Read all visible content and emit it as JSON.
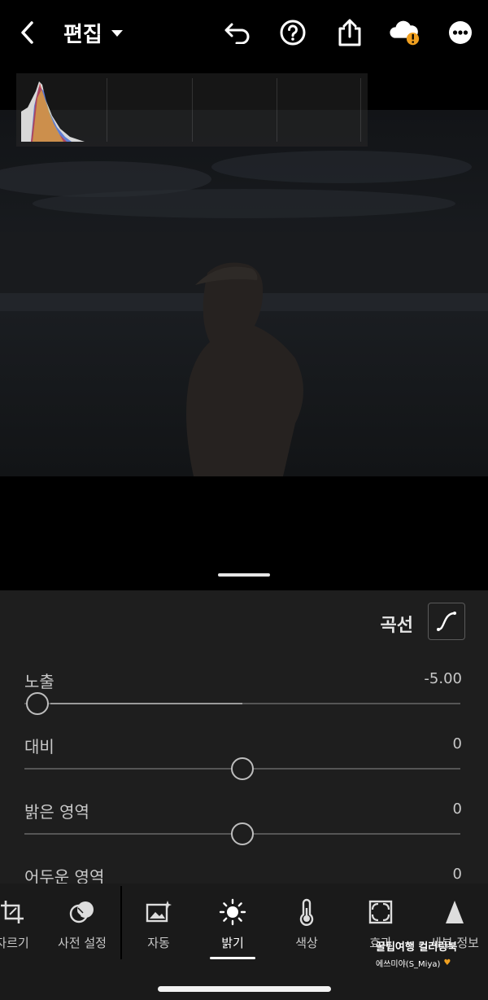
{
  "header": {
    "title": "편집"
  },
  "curve": {
    "label": "곡선"
  },
  "sliders": [
    {
      "label": "노출",
      "value": "-5.00",
      "level": 0.0
    },
    {
      "label": "대비",
      "value": "0",
      "level": 0.5
    },
    {
      "label": "밝은 영역",
      "value": "0",
      "level": 0.5
    },
    {
      "label": "어두운 영역",
      "value": "0",
      "level": 0.5
    }
  ],
  "tabs": [
    {
      "label": "자르기",
      "icon": "crop-icon"
    },
    {
      "label": "사전 설정",
      "icon": "presets-icon"
    },
    {
      "label": "자동",
      "icon": "auto-icon"
    },
    {
      "label": "밝기",
      "icon": "light-icon"
    },
    {
      "label": "색상",
      "icon": "color-thermometer-icon"
    },
    {
      "label": "효과",
      "icon": "effects-icon"
    },
    {
      "label": "세부 정보",
      "icon": "detail-icon"
    }
  ],
  "watermark": {
    "line1": "꿀팁여행 컬러링북",
    "line2": "에쓰미야(S_Miya)"
  },
  "colors": {
    "background": "#000000",
    "panel": "#1e1e1e",
    "tabbar": "#1a1a1a",
    "cloud_alert": "#f0a020"
  }
}
